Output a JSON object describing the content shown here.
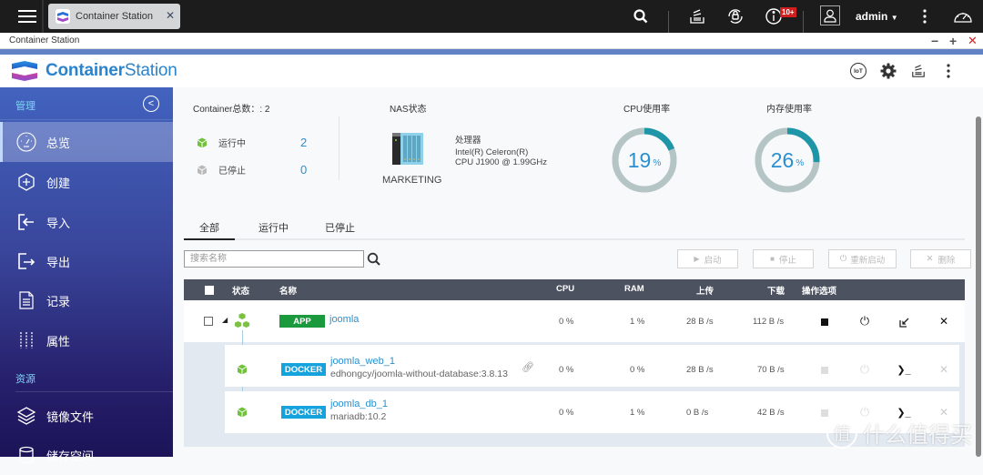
{
  "topbar": {
    "tab_title": "Container Station",
    "notification_badge": "10+",
    "user": "admin",
    "icons": [
      "menu-icon",
      "search-icon",
      "stack-icon",
      "sync-icon",
      "info-icon",
      "user-icon",
      "more-vertical-icon",
      "dashboard-gauge-icon"
    ]
  },
  "window": {
    "title": "Container Station",
    "minimize": "−",
    "maximize": "+",
    "close": "✕"
  },
  "app": {
    "logo_bold": "Container",
    "logo_light": "Station",
    "header_icons": [
      "iot-icon",
      "gear-icon",
      "stack-icon",
      "more-vertical-icon"
    ],
    "iot_label": "IoT"
  },
  "sidebar": {
    "section_manage": "管理",
    "section_resources": "资源",
    "items": [
      {
        "label": "总览",
        "icon": "dashboard-icon",
        "active": true
      },
      {
        "label": "创建",
        "icon": "add-hex-icon"
      },
      {
        "label": "导入",
        "icon": "import-icon"
      },
      {
        "label": "导出",
        "icon": "export-icon"
      },
      {
        "label": "记录",
        "icon": "document-icon"
      },
      {
        "label": "属性",
        "icon": "sliders-icon"
      }
    ],
    "resource_items": [
      {
        "label": "镜像文件",
        "icon": "layers-icon"
      },
      {
        "label": "储存空间",
        "icon": "storage-icon"
      }
    ]
  },
  "summary": {
    "container_total_label": "Container总数：: 2",
    "running_label": "运行中",
    "running_count": "2",
    "stopped_label": "已停止",
    "stopped_count": "0",
    "nas_label": "NAS状态",
    "nas_name": "MARKETING",
    "processor_label": "处理器",
    "processor_line1": "Intel(R) Celeron(R)",
    "processor_line2": "CPU J1900 @ 1.99GHz",
    "cpu_label": "CPU使用率",
    "cpu_value": "19",
    "cpu_percent": 19,
    "mem_label": "内存使用率",
    "mem_value": "26",
    "mem_percent": 26,
    "percent_sign": "%"
  },
  "tabs": [
    {
      "label": "全部",
      "active": true
    },
    {
      "label": "运行中"
    },
    {
      "label": "已停止"
    }
  ],
  "search": {
    "placeholder": "搜索名称"
  },
  "actions": {
    "start": "启动",
    "stop": "停止",
    "restart": "重新启动",
    "delete": "删除"
  },
  "table": {
    "headers": {
      "status": "状态",
      "name": "名称",
      "cpu": "CPU",
      "ram": "RAM",
      "upload": "上传",
      "download": "下载",
      "ops": "操作选项"
    },
    "app_row": {
      "type": "APP",
      "name": "joomla",
      "cpu": "0 %",
      "ram": "1 %",
      "upload": "28 B /s",
      "download": "112 B /s"
    },
    "children": [
      {
        "type": "DOCKER",
        "name": "joomla_web_1",
        "image": "edhongcy/joomla-without-database:3.8.13",
        "cpu": "0 %",
        "ram": "0 %",
        "upload": "28 B /s",
        "download": "70 B /s"
      },
      {
        "type": "DOCKER",
        "name": "joomla_db_1",
        "image": "mariadb:10.2",
        "cpu": "0 %",
        "ram": "1 %",
        "upload": "0 B /s",
        "download": "42 B /s"
      }
    ]
  },
  "watermark": {
    "circle": "值",
    "text": "什么值得买"
  },
  "colors": {
    "accent": "#2b8fcf",
    "app_tag": "#1a9a3c",
    "docker_tag": "#16a3dd",
    "table_header": "#4c5260",
    "gauge_track": "#b5c4c4",
    "gauge_fill": "#1f95a8"
  }
}
